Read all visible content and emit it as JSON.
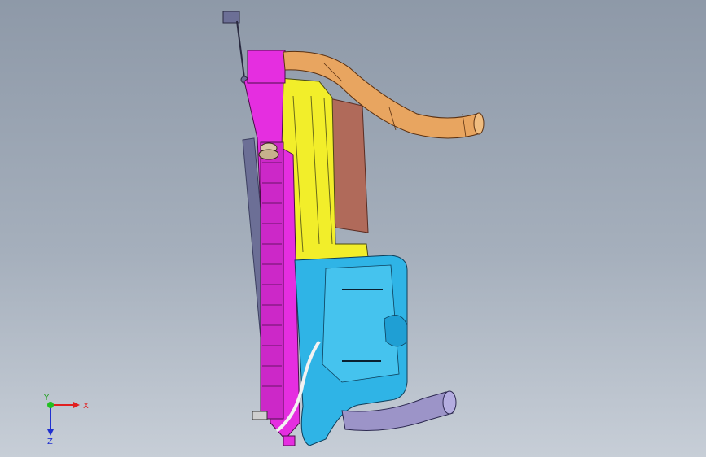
{
  "viewport": {
    "colors": {
      "background_top": "#8e99a8",
      "background_bottom": "#c7ced7",
      "radiator": "#e52ee0",
      "shroud": "#f2ee2a",
      "tank": "#2fb4e6",
      "hose": "#e8a560",
      "fan": "#b06a5a",
      "pipe": "#9c94c8",
      "plate": "#6c6f96"
    }
  },
  "triad": {
    "x_label": "X",
    "y_label": "Y",
    "z_label": "Z"
  }
}
